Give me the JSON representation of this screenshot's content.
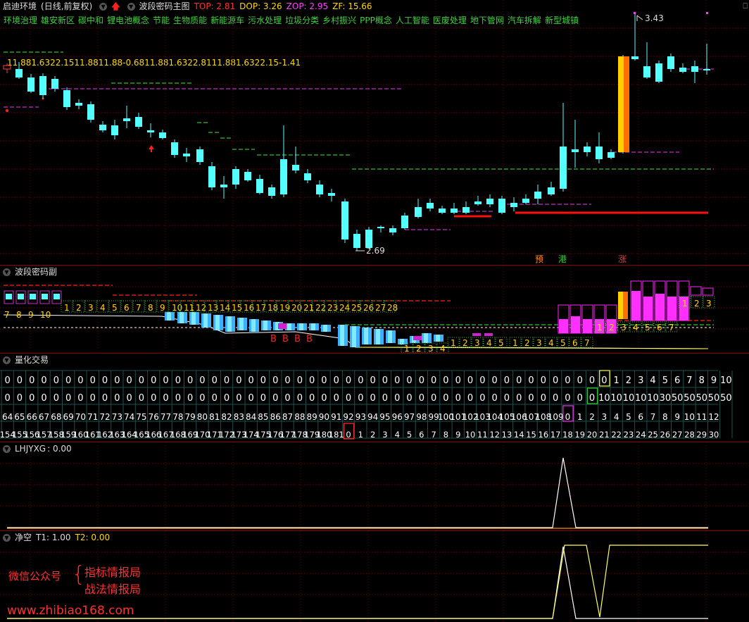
{
  "main": {
    "stock_name": "启迪环境",
    "period": "(日线,前复权)",
    "indicator_name": "波段密码主图",
    "top_label": "TOP: 2.81",
    "dop_label": "DOP: 3.26",
    "zop_label": "ZOP: 2.95",
    "zf_label": "ZF: 15.66",
    "concepts": [
      "环境治理",
      "雄安新区",
      "碳中和",
      "锂电池概念",
      "节能",
      "生物质能",
      "新能源车",
      "污水处理",
      "垃圾分类",
      "乡村振兴",
      "PPP概念",
      "人工智能",
      "医废处理",
      "地下管网",
      "汽车拆解",
      "新型城镇"
    ],
    "values_text": "11.881.6322.1511.8811.88-0.6811.881.6322.8111.881.6322.15-1.41",
    "high_label": "3.43",
    "low_label": "2.69",
    "tags": [
      "预",
      "港",
      "涨"
    ],
    "colors": {
      "up": "#ff3c3c",
      "down": "#54ffff",
      "magenta": "#c030c0",
      "green": "#30c030",
      "red": "#ff0000",
      "yellow": "#ffd800"
    }
  },
  "sub1": {
    "title": "波段密码副",
    "row1_numbers": [
      "7",
      "8",
      "9",
      "10"
    ],
    "row2_numbers": [
      "1",
      "2",
      "3",
      "4",
      "5",
      "6",
      "7",
      "8",
      "9",
      "10",
      "11",
      "12",
      "13",
      "14",
      "15",
      "16",
      "17",
      "18",
      "19",
      "20",
      "21",
      "22",
      "23",
      "24",
      "25",
      "26",
      "27",
      "28"
    ],
    "b_markers": [
      "B",
      "B",
      "B",
      "B"
    ],
    "row3_numbers": [
      "1",
      "2",
      "3",
      "4",
      "5",
      "1",
      "2",
      "3",
      "4",
      "5",
      "6",
      "7"
    ],
    "row4_numbers": [
      "1",
      "2",
      "3",
      "4"
    ],
    "row5_numbers": [
      "1",
      "2",
      "3",
      "4",
      "5",
      "6",
      "7"
    ],
    "row6_numbers": [
      "1",
      "2",
      "3"
    ]
  },
  "sub2": {
    "title": "量化交易",
    "row1": [
      "0",
      "0",
      "0",
      "0",
      "0",
      "0",
      "0",
      "0",
      "0",
      "0",
      "0",
      "0",
      "0",
      "0",
      "0",
      "0",
      "0",
      "0",
      "0",
      "0",
      "0",
      "0",
      "0",
      "0",
      "0",
      "0",
      "0",
      "0",
      "0",
      "0",
      "0",
      "0",
      "0",
      "0",
      "0",
      "0",
      "0",
      "0",
      "0",
      "0",
      "0",
      "0",
      "0",
      "0",
      "0",
      "0",
      "0",
      "0",
      "0",
      "0",
      "1",
      "2",
      "3",
      "4",
      "5",
      "6",
      "7",
      "8",
      "9",
      "10"
    ],
    "row2": [
      "0",
      "0",
      "0",
      "0",
      "0",
      "0",
      "0",
      "0",
      "0",
      "0",
      "0",
      "0",
      "0",
      "0",
      "0",
      "0",
      "0",
      "0",
      "0",
      "0",
      "0",
      "0",
      "0",
      "0",
      "0",
      "0",
      "0",
      "0",
      "0",
      "0",
      "0",
      "0",
      "0",
      "0",
      "0",
      "0",
      "0",
      "0",
      "0",
      "0",
      "0",
      "0",
      "0",
      "0",
      "0",
      "0",
      "0",
      "0",
      "0",
      "10",
      "10",
      "10",
      "10",
      "10",
      "30",
      "50",
      "50",
      "50",
      "50",
      "50"
    ],
    "row3": [
      "64",
      "65",
      "66",
      "67",
      "68",
      "69",
      "70",
      "71",
      "72",
      "73",
      "74",
      "75",
      "76",
      "77",
      "78",
      "79",
      "80",
      "81",
      "82",
      "83",
      "84",
      "85",
      "86",
      "87",
      "88",
      "89",
      "90",
      "91",
      "92",
      "93",
      "94",
      "95",
      "96",
      "97",
      "98",
      "99",
      "100",
      "101",
      "102",
      "103",
      "104",
      "105",
      "106",
      "107",
      "108",
      "109",
      "0",
      "1",
      "2",
      "3",
      "4",
      "5",
      "6",
      "7",
      "8",
      "9",
      "10",
      "11",
      "12"
    ],
    "row3_spans": [
      "55",
      "56",
      "57",
      "58"
    ],
    "row4": [
      "154",
      "155",
      "156",
      "157",
      "158",
      "159",
      "160",
      "161",
      "162",
      "163",
      "164",
      "165",
      "166",
      "167",
      "168",
      "169",
      "170",
      "171",
      "172",
      "173",
      "174",
      "175",
      "176",
      "177",
      "178",
      "179",
      "180",
      "181",
      "0",
      "1",
      "2",
      "3",
      "4",
      "5",
      "6",
      "7",
      "8",
      "9",
      "10",
      "11",
      "12",
      "13",
      "14",
      "15",
      "16",
      "17",
      "18",
      "19",
      "20",
      "21",
      "22",
      "23",
      "24",
      "25",
      "26",
      "27",
      "28",
      "29",
      "30"
    ]
  },
  "sub3": {
    "title": "LHJYXG",
    "value_label": ": 0.00"
  },
  "sub4": {
    "title": "净空",
    "t1_label": "T1: 1.00",
    "t2_label": "T2: 0.00"
  },
  "watermark": {
    "wechat_label": "微信公众号",
    "line1": "指标情报局",
    "line2": "战法情报局",
    "url": "www.zhibiao168.com"
  }
}
